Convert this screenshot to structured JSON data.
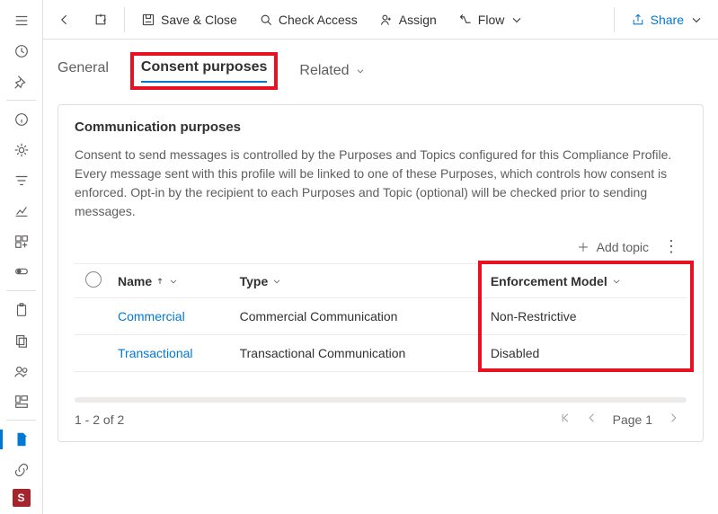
{
  "commandbar": {
    "save_close": "Save & Close",
    "check_access": "Check Access",
    "assign": "Assign",
    "flow": "Flow",
    "share": "Share"
  },
  "tabs": {
    "general": "General",
    "consent_purposes": "Consent purposes",
    "related": "Related"
  },
  "card": {
    "title": "Communication purposes",
    "description": "Consent to send messages is controlled by the Purposes and Topics configured for this Compliance Profile. Every message sent with this profile will be linked to one of these Purposes, which controls how consent is enforced. Opt-in by the recipient to each Purposes and Topic (optional) will be checked prior to sending messages.",
    "add_topic": "Add topic"
  },
  "table": {
    "headers": {
      "name": "Name",
      "type": "Type",
      "enforcement_model": "Enforcement Model"
    },
    "rows": [
      {
        "name": "Commercial",
        "type": "Commercial Communication",
        "enforcement_model": "Non-Restrictive"
      },
      {
        "name": "Transactional",
        "type": "Transactional Communication",
        "enforcement_model": "Disabled"
      }
    ]
  },
  "pager": {
    "range": "1 - 2 of 2",
    "page_label": "Page 1"
  },
  "badge": "S"
}
